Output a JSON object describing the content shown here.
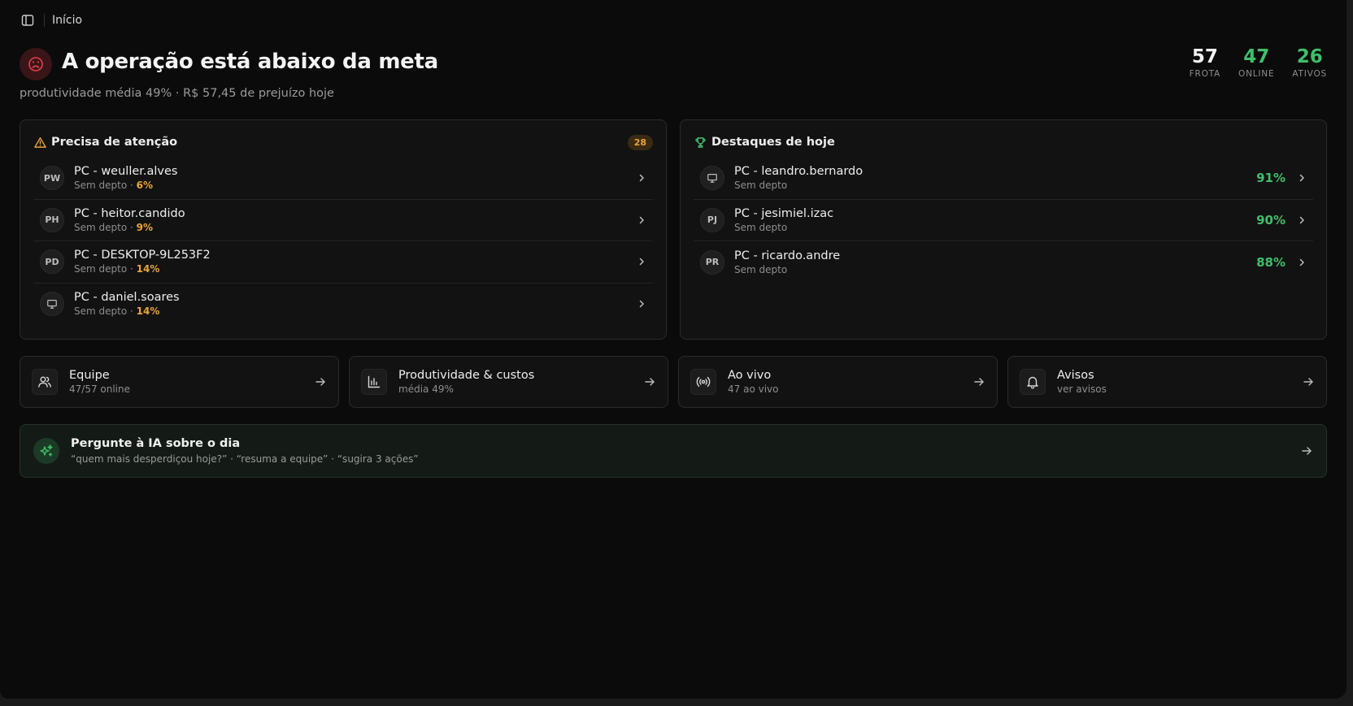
{
  "topbar": {
    "breadcrumb": "Início"
  },
  "header": {
    "title": "A operação está abaixo da meta",
    "subtitle": "produtividade média 49% · R$ 57,45 de prejuízo hoje",
    "status_color": "#e0414b"
  },
  "stats": [
    {
      "value": "57",
      "label": "FROTA",
      "color": "#f3f3f3"
    },
    {
      "value": "47",
      "label": "ONLINE",
      "color": "#3fbf6a"
    },
    {
      "value": "26",
      "label": "ATIVOS",
      "color": "#3fbf6a"
    }
  ],
  "attention": {
    "title": "Precisa de atenção",
    "count": "28",
    "items": [
      {
        "avatar": "PW",
        "name": "PC - weuller.alves",
        "dept": "Sem depto · ",
        "pct": "6%"
      },
      {
        "avatar": "PH",
        "name": "PC - heitor.candido",
        "dept": "Sem depto · ",
        "pct": "9%"
      },
      {
        "avatar": "PD",
        "name": "PC - DESKTOP-9L253F2",
        "dept": "Sem depto · ",
        "pct": "14%"
      },
      {
        "avatar": "monitor-icon",
        "name": "PC - daniel.soares",
        "dept": "Sem depto · ",
        "pct": "14%"
      }
    ]
  },
  "highlights": {
    "title": "Destaques de hoje",
    "items": [
      {
        "avatar": "monitor-icon",
        "name": "PC - leandro.bernardo",
        "dept": "Sem depto",
        "pct": "91%"
      },
      {
        "avatar": "PJ",
        "name": "PC - jesimiel.izac",
        "dept": "Sem depto",
        "pct": "90%"
      },
      {
        "avatar": "PR",
        "name": "PC - ricardo.andre",
        "dept": "Sem depto",
        "pct": "88%"
      }
    ]
  },
  "cards": [
    {
      "icon": "users-icon",
      "title": "Equipe",
      "sub": "47/57 online"
    },
    {
      "icon": "bar-chart-icon",
      "title": "Produtividade & custos",
      "sub": "média 49%"
    },
    {
      "icon": "broadcast-icon",
      "title": "Ao vivo",
      "sub": "47 ao vivo"
    },
    {
      "icon": "bell-icon",
      "title": "Avisos",
      "sub": "ver avisos"
    }
  ],
  "ai": {
    "title": "Pergunte à IA sobre o dia",
    "suggestions": "“quem mais desperdiçou hoje?” · “resuma a equipe” · “sugira 3 ações”"
  },
  "colors": {
    "accent_green": "#3fbf6a",
    "warning_orange": "#e9a43a",
    "danger_red": "#e0414b"
  }
}
